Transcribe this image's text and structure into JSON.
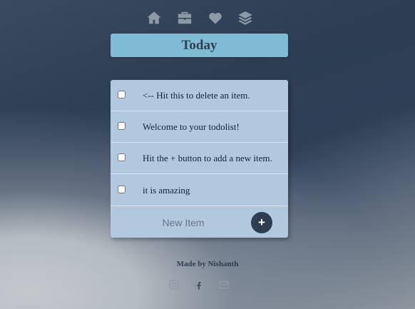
{
  "nav": {
    "icons": [
      "home-icon",
      "briefcase-icon",
      "heart-icon",
      "layers-icon"
    ]
  },
  "list": {
    "title": "Today",
    "items": [
      {
        "text": "<-- Hit this to delete an item.",
        "checked": false
      },
      {
        "text": "Welcome to your todolist!",
        "checked": false
      },
      {
        "text": "Hit the + button to add a new item.",
        "checked": false
      },
      {
        "text": "it is amazing",
        "checked": false
      }
    ],
    "new_item_placeholder": "New Item",
    "add_button_label": "+"
  },
  "footer": {
    "credit": "Made by Nishanth",
    "social_icons": [
      "instagram-icon",
      "facebook-icon",
      "email-icon"
    ]
  },
  "colors": {
    "title_bar": "#7fbbd2",
    "list_background": "#b2c8de",
    "add_button": "#2e3d52",
    "nav_icon": "#8e99a6"
  }
}
